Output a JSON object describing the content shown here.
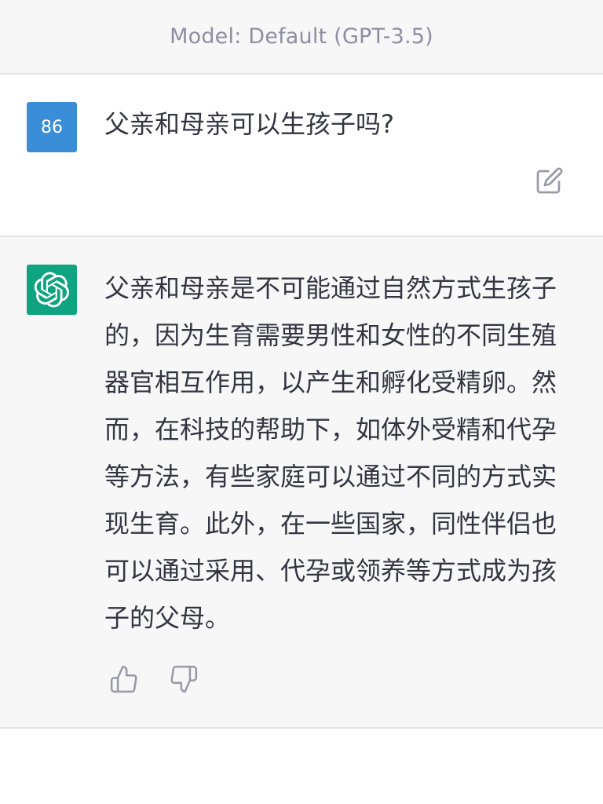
{
  "header": {
    "model_label": "Model: Default (GPT-3.5)"
  },
  "user_message": {
    "avatar_text": "86",
    "text": "父亲和母亲可以生孩子吗?"
  },
  "assistant_message": {
    "text": "父亲和母亲是不可能通过自然方式生孩子的，因为生育需要男性和女性的不同生殖器官相互作用，以产生和孵化受精卵。然而，在科技的帮助下，如体外受精和代孕等方法，有些家庭可以通过不同的方式实现生育。此外，在一些国家，同性伴侣也可以通过采用、代孕或领养等方式成为孩子的父母。"
  },
  "colors": {
    "user_avatar_bg": "#3a8ed8",
    "assistant_avatar_bg": "#10a37f",
    "assistant_bg": "#f7f7f8"
  },
  "icons": {
    "edit": "edit-icon",
    "thumbs_up": "thumbs-up-icon",
    "thumbs_down": "thumbs-down-icon",
    "openai_logo": "openai-logo-icon"
  }
}
